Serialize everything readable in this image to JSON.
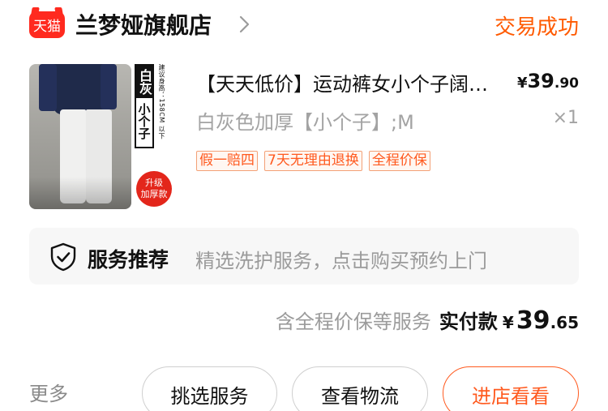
{
  "shop": {
    "logo_text": "天猫",
    "name": "兰梦娅旗舰店",
    "status": "交易成功"
  },
  "product": {
    "title": "【天天低价】运动裤女小个子阔腿裤",
    "price_symbol": "¥",
    "price_int": "39",
    "price_dec": ".90",
    "sku": "白灰色加厚【小个子】;M",
    "quantity": "×1",
    "image_tag": {
      "color_text": "白灰",
      "size_text": "小个子",
      "side_note": "建议身高：158CM 以下",
      "badge_line1": "升级",
      "badge_line2": "加厚款"
    },
    "tags": [
      "假一赔四",
      "7天无理由退换",
      "全程价保"
    ]
  },
  "service": {
    "icon": "shield-check-icon",
    "title": "服务推荐",
    "description": "精选洗护服务，点击购买预约上门"
  },
  "summary": {
    "note": "含全程价保等服务",
    "label": "实付款",
    "symbol": "¥",
    "int": "39",
    "dec": ".65"
  },
  "actions": {
    "more": "更多",
    "select_service": "挑选服务",
    "view_logistics": "查看物流",
    "enter_shop": "进店看看"
  },
  "colors": {
    "accent": "#ff5a00",
    "tmall_red": "#ff2a1f",
    "muted": "#9b9b9b"
  }
}
